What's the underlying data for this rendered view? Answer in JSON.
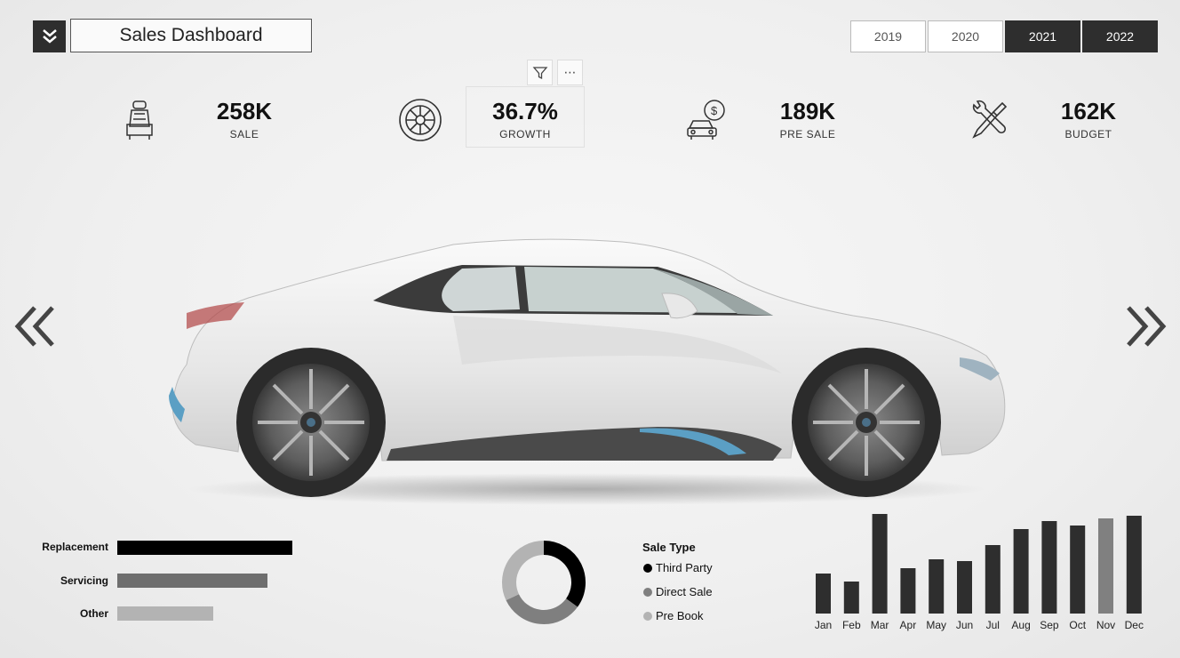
{
  "header": {
    "title": "Sales Dashboard",
    "menu_icon": "double-chevron-down-icon",
    "years": [
      {
        "label": "2019",
        "selected": false
      },
      {
        "label": "2020",
        "selected": false
      },
      {
        "label": "2021",
        "selected": true
      },
      {
        "label": "2022",
        "selected": true
      }
    ]
  },
  "visual_toolbar": {
    "filter_icon": "filter-icon",
    "more_label": "⋯"
  },
  "kpis": [
    {
      "icon": "car-seat-icon",
      "value": "258K",
      "label": "SALE"
    },
    {
      "icon": "tire-icon",
      "value": "36.7%",
      "label": "GROWTH"
    },
    {
      "icon": "car-dollar-icon",
      "value": "189K",
      "label": "PRE SALE"
    },
    {
      "icon": "tools-icon",
      "value": "162K",
      "label": "BUDGET"
    }
  ],
  "nav": {
    "prev_icon": "double-chevron-left-icon",
    "next_icon": "double-chevron-right-icon"
  },
  "colors": {
    "dark": "#2e2e2e",
    "black": "#000000",
    "mid": "#6e6e6e",
    "light": "#b3b3b3",
    "highlight": "#808080",
    "accent_blue": "#5b9fc4"
  },
  "chart_data": [
    {
      "type": "bar",
      "orientation": "horizontal",
      "categories": [
        "Replacement",
        "Servicing",
        "Other"
      ],
      "values": [
        100,
        86,
        55
      ],
      "colors": [
        "#000000",
        "#6e6e6e",
        "#b3b3b3"
      ]
    },
    {
      "type": "pie",
      "donut": true,
      "title": "Sale Type",
      "labels": [
        "Third Party",
        "Direct Sale",
        "Pre Book"
      ],
      "values": [
        35,
        33,
        32
      ],
      "colors": [
        "#000000",
        "#7f7f7f",
        "#b3b3b3"
      ]
    },
    {
      "type": "bar",
      "categories": [
        "Jan",
        "Feb",
        "Mar",
        "Apr",
        "May",
        "Jun",
        "Jul",
        "Aug",
        "Sep",
        "Oct",
        "Nov",
        "Dec"
      ],
      "values": [
        45,
        36,
        112,
        51,
        61,
        59,
        77,
        95,
        104,
        99,
        107,
        110
      ],
      "highlight_index": 10,
      "ylim": [
        0,
        112
      ]
    }
  ]
}
